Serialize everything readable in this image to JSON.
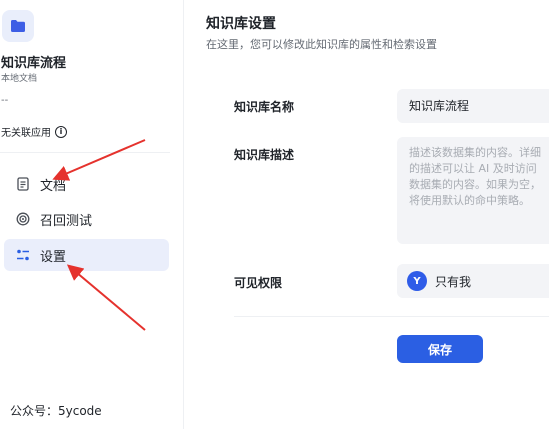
{
  "sidebar": {
    "kb_icon": "folder-icon",
    "kb_name": "知识库流程",
    "kb_type": "本地文档",
    "kb_desc": "--",
    "kb_app": "无关联应用",
    "nav": [
      {
        "label": "文档",
        "icon": "document-icon"
      },
      {
        "label": "召回测试",
        "icon": "target-icon"
      },
      {
        "label": "设置",
        "icon": "settings-icon"
      }
    ],
    "footer": "公众号：5ycode"
  },
  "main": {
    "title": "知识库设置",
    "subtitle": "在这里，您可以修改此知识库的属性和检索设置",
    "form": {
      "name_label": "知识库名称",
      "name_value": "知识库流程",
      "desc_label": "知识库描述",
      "desc_placeholder": "描述该数据集的内容。详细的描述可以让 AI 及时访问数据集的内容。如果为空，将使用默认的命中策略。",
      "perm_label": "可见权限",
      "perm_avatar": "Y",
      "perm_value": "只有我",
      "save_label": "保存"
    }
  },
  "colors": {
    "accent": "#2b5fe3",
    "active_nav_bg": "#eaeefb",
    "annotation_arrow": "#e5322d"
  }
}
